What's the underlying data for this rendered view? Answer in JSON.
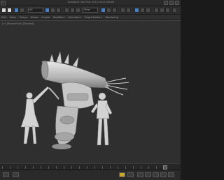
{
  "window": {
    "title": "Autodesk 3ds Max 2014 x64    Untitled"
  },
  "toolbar": {
    "selection_filter": "All",
    "view_dropdown": "View"
  },
  "menubar": {
    "items": [
      "Edit",
      "Tools",
      "Group",
      "Views",
      "Create",
      "Modifiers",
      "Animation",
      "Graph Editors",
      "Rendering"
    ]
  },
  "viewport": {
    "label": "[+] [Perspective] [Shaded]"
  },
  "timeline": {
    "frame_value": 0
  },
  "colors": {
    "accent": "#4b7fbf",
    "viewport_bg": "#2f2f2f",
    "model": "#d0d0d0"
  }
}
